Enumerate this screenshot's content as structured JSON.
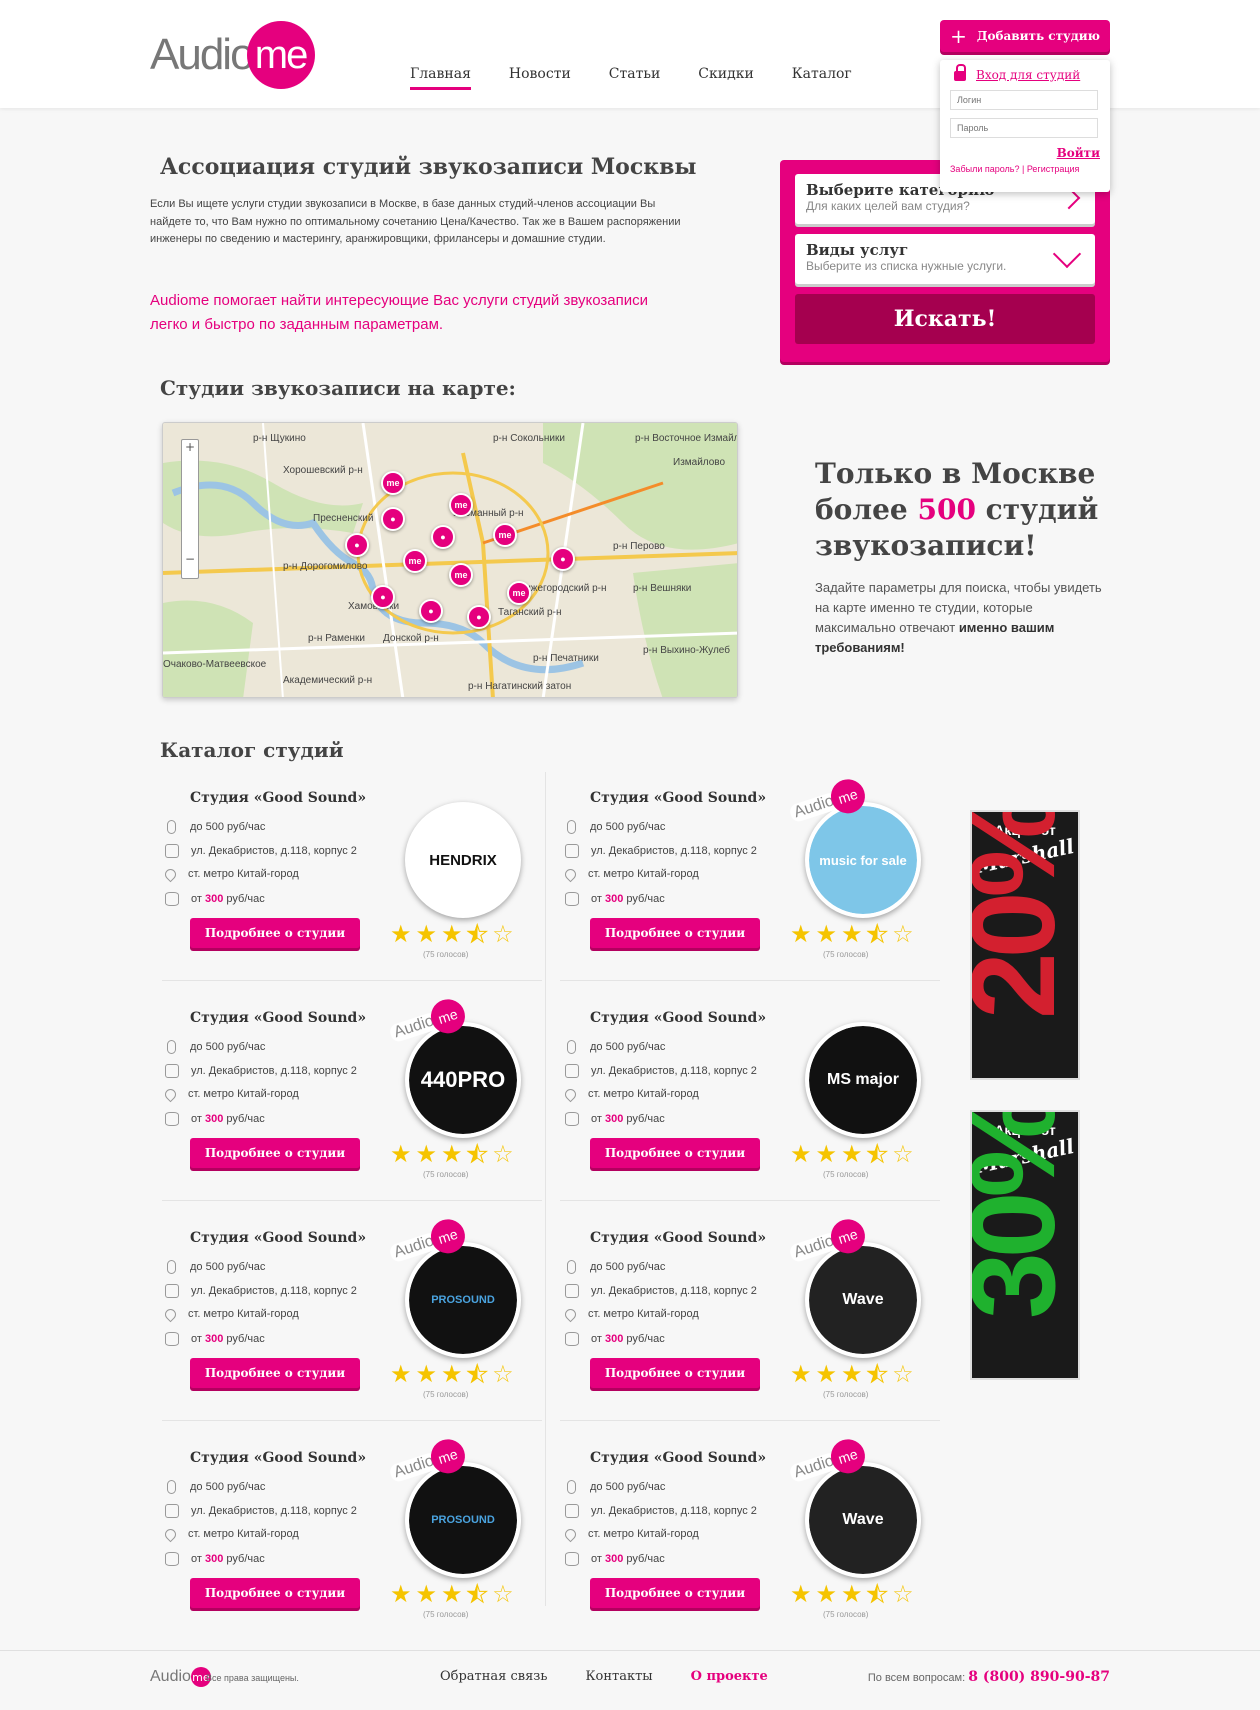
{
  "header": {
    "logo_text": "Audio",
    "logo_circle": "me",
    "nav": [
      "Главная",
      "Новости",
      "Статьи",
      "Скидки",
      "Каталог"
    ],
    "add_studio": "Добавить студию",
    "login": {
      "title": "Вход для студий",
      "login_placeholder": "Логин",
      "password_placeholder": "Пароль",
      "submit": "Войти",
      "forgot": "Забыли пароль? | Регистрация"
    }
  },
  "intro": {
    "title": "Ассоциация студий звукозаписи Москвы",
    "text": "Если Вы ищете услуги студии звукозаписи в Москве, в базе данных студий-членов ассоциации Вы найдете то, что Вам нужно по оптимальному сочетанию Цена/Качество. Так же в Вашем распоряжении инженеры по сведению и мастерингу, аранжировщики, фрилансеры и домашние студии.",
    "highlight_brand": "Audiome",
    "highlight_text": " помогает найти интересующие Вас услуги студий звукозаписи легко и быстро по заданным параметрам."
  },
  "search": {
    "category_title": "Выберите категорию",
    "category_sub": "Для каких целей вам студия?",
    "services_title": "Виды услуг",
    "services_sub": "Выберите из списка нужные услуги.",
    "button": "Искать!"
  },
  "map": {
    "title": "Студии звукозаписи на карте:",
    "labels": [
      "Хорошевский р-н",
      "р-н Щукино",
      "р-н Сокольники",
      "р-н Восточное Измайлово",
      "Измайлово",
      "Пресненский",
      "Басманный р-н",
      "р-н Дорогомилово",
      "р-н Перово",
      "р-н Раменки",
      "Донской р-н",
      "р-н Печатники",
      "Академический р-н",
      "р-н Нагатинский затон",
      "р-н Вешняки",
      "р-н Выхино-Жулеб",
      "Очаково-Матвеевское",
      "Нижегородский р-н",
      "Таганский р-н",
      "Хамовники"
    ],
    "zoom_plus": "+",
    "zoom_minus": "−",
    "pin_label": "me"
  },
  "promo": {
    "line1": "Только в Москве",
    "line2_pre": "более ",
    "number": "500",
    "line2_post": " студий",
    "line3": "звукозаписи!",
    "text": "Задайте параметры для поиска, чтобы увидеть на карте именно те студии, которые максимально отвечают ",
    "text_bold": "именно вашим требованиям!"
  },
  "catalog": {
    "title": "Каталог студий",
    "card_title": "Студия «Good Sound»",
    "price_range": "до 500 руб/час",
    "address": "ул. Декабристов, д.118, корпус 2",
    "metro": "ст. метро Китай-город",
    "price_from_pre": "от ",
    "price_from_val": "300",
    "price_from_post": " руб/час",
    "button": "Подробнее о студии",
    "votes": "(75 голосов)",
    "rating": 3.5,
    "badge_text": "Audio",
    "badge_circle": "me",
    "logos": [
      "HENDRIX",
      "music for sale",
      "440PRO",
      "MS major",
      "PROSOUND",
      "Wave",
      "PROSOUND",
      "Wave"
    ]
  },
  "banners": [
    {
      "top": "Акция от",
      "brand": "Marshall",
      "value": "20%",
      "color": "#d3202f"
    },
    {
      "top": "Акция от",
      "brand": "Marshall",
      "value": "30%",
      "color": "#1fb12e"
    }
  ],
  "footer": {
    "logo_text": "Audio",
    "logo_circle": "me",
    "copyright": "Все права защищены.",
    "links": [
      "Обратная связь",
      "Контакты",
      "О проекте"
    ],
    "phone_label": "По всем вопросам: ",
    "phone": "8 (800) 890-90-87"
  }
}
